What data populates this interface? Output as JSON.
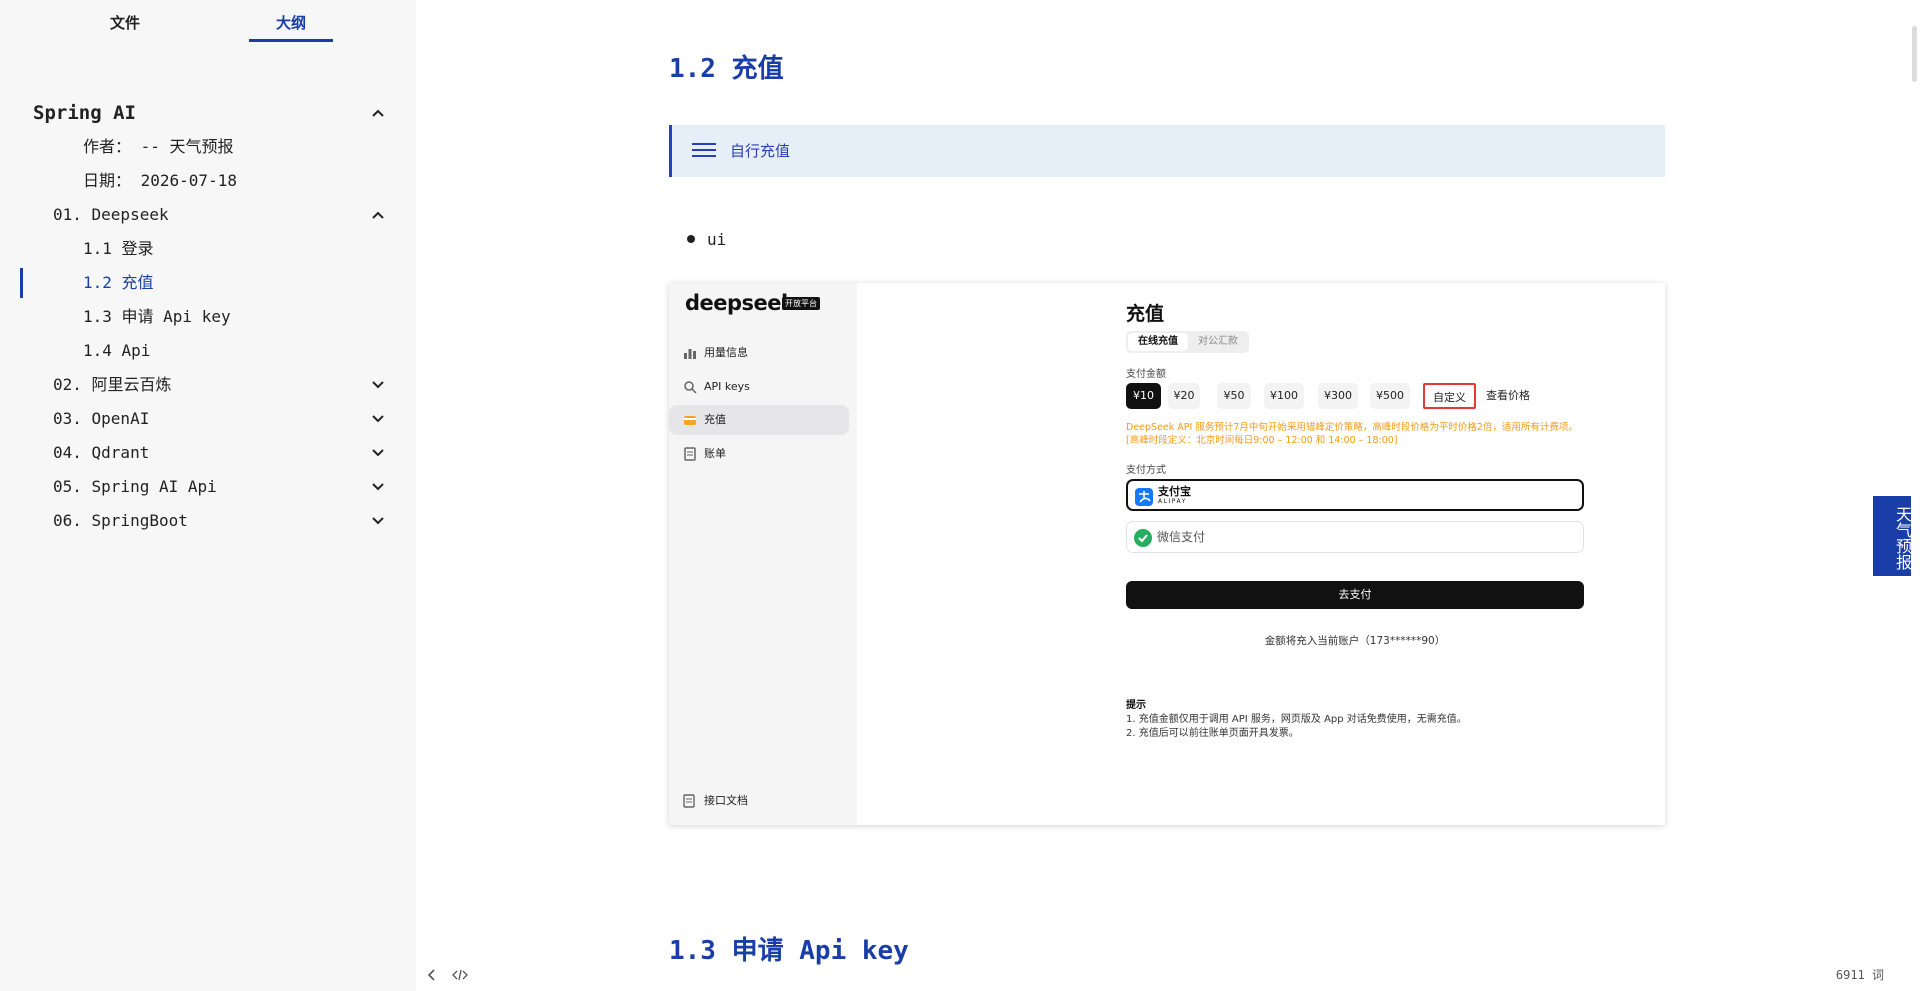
{
  "sidebar": {
    "tabs": {
      "file": "文件",
      "outline": "大纲"
    },
    "outline": [
      {
        "label": "Spring AI",
        "level": "root",
        "expanded": true
      },
      {
        "label": "作者： -- 天气预报",
        "level": "meta"
      },
      {
        "label": "日期： 2026-07-18",
        "level": "meta"
      },
      {
        "label": "01. Deepseek",
        "level": "h1",
        "expanded": true
      },
      {
        "label": "1.1 登录",
        "level": "h2"
      },
      {
        "label": "1.2 充值",
        "level": "h2",
        "active": true
      },
      {
        "label": "1.3 申请 Api key",
        "level": "h2"
      },
      {
        "label": "1.4 Api",
        "level": "h2"
      },
      {
        "label": "02. 阿里云百炼",
        "level": "h1",
        "expanded": false
      },
      {
        "label": "03. OpenAI",
        "level": "h1",
        "expanded": false
      },
      {
        "label": "04. Qdrant",
        "level": "h1",
        "expanded": false
      },
      {
        "label": "05. Spring AI Api",
        "level": "h1",
        "expanded": false
      },
      {
        "label": "06. SpringBoot",
        "level": "h1",
        "expanded": false
      }
    ]
  },
  "content": {
    "heading": "1.2 充值",
    "callout": "自行充值",
    "bullet": "ui",
    "next_heading": "1.3 申请 Api key"
  },
  "shot": {
    "logo": "deepseek",
    "badge": "开放平台",
    "nav": [
      "用量信息",
      "API keys",
      "充值",
      "账单"
    ],
    "nav_selected": "充值",
    "docs": "接口文档",
    "title": "充值",
    "seg": [
      "在线充值",
      "对公汇款"
    ],
    "amount_label": "支付金额",
    "amounts": [
      "¥10",
      "¥20",
      "¥50",
      "¥100",
      "¥300",
      "¥500",
      "自定义"
    ],
    "amount_selected": "¥10",
    "price_link": "查看价格",
    "warning": "DeepSeek API 服务预计7月中旬开始采用错峰定价策略，高峰时段价格为平时价格2倍，适用所有计费项。 [高峰时段定义：北京时间每日9:00 – 12:00 和 14:00 – 18:00]",
    "method_label": "支付方式",
    "alipay": "支付宝",
    "alipay_sub": "ALIPAY",
    "wechat": "微信支付",
    "pay_button": "去支付",
    "account": "金额将充入当前账户（173******90）",
    "tips_title": "提示",
    "tips": [
      "1. 充值金额仅用于调用 API 服务，网页版及 App 对话免费使用，无需充值。",
      "2. 充值后可以前往账单页面开具发票。"
    ]
  },
  "float_button": "天气预报",
  "status": {
    "words": "6911 词"
  },
  "colors": {
    "accent": "#1a3ea8",
    "callout_bg": "#e6eef8",
    "warning": "#f39c12",
    "mark": "#e53935"
  }
}
